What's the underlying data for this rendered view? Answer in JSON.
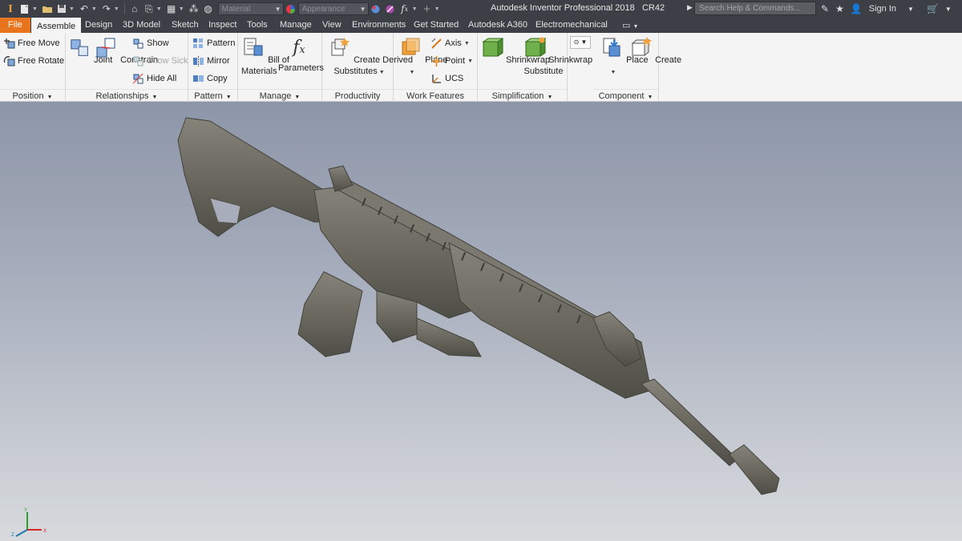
{
  "app": {
    "title": "Autodesk Inventor Professional 2018",
    "document_name": "CR42"
  },
  "quick_access": {
    "material_placeholder": "Material",
    "appearance_placeholder": "Appearance"
  },
  "search": {
    "placeholder": "Search Help & Commands..."
  },
  "account": {
    "sign_in": "Sign In"
  },
  "tabs": [
    {
      "label": "File"
    },
    {
      "label": "Assemble"
    },
    {
      "label": "Design"
    },
    {
      "label": "3D Model"
    },
    {
      "label": "Sketch"
    },
    {
      "label": "Inspect"
    },
    {
      "label": "Tools"
    },
    {
      "label": "Manage"
    },
    {
      "label": "View"
    },
    {
      "label": "Environments"
    },
    {
      "label": "Get Started"
    },
    {
      "label": "Autodesk A360"
    },
    {
      "label": "Electromechanical"
    }
  ],
  "ribbon": {
    "position": {
      "footer": "Position",
      "free_move": "Free Move",
      "free_rotate": "Free Rotate"
    },
    "relationships": {
      "footer": "Relationships",
      "joint": "Joint",
      "constrain": "Constrain",
      "show": "Show",
      "show_sick": "Show Sick",
      "hide_all": "Hide All"
    },
    "pattern": {
      "footer": "Pattern",
      "pattern": "Pattern",
      "mirror": "Mirror",
      "copy": "Copy"
    },
    "manage": {
      "footer": "Manage",
      "bom_line1": "Bill of",
      "bom_line2": "Materials",
      "parameters": "Parameters"
    },
    "productivity": {
      "footer": "Productivity",
      "line1": "Create Derived",
      "line2": "Substitutes"
    },
    "work_features": {
      "footer": "Work Features",
      "plane": "Plane",
      "axis": "Axis",
      "point": "Point",
      "ucs": "UCS"
    },
    "simplification": {
      "footer": "Simplification",
      "shrinkwrap": "Shrinkwrap",
      "sws_line1": "Shrinkwrap",
      "sws_line2": "Substitute"
    },
    "component": {
      "footer": "Component",
      "place": "Place",
      "create": "Create"
    }
  },
  "triad": {
    "x_label": "X",
    "y_label": "Y",
    "z_label": "Z"
  },
  "colors": {
    "file_tab": "#e8741e",
    "titlebar": "#3c3f45",
    "ribbon_bg": "#f4f4f4",
    "model": "#6e6c62"
  }
}
